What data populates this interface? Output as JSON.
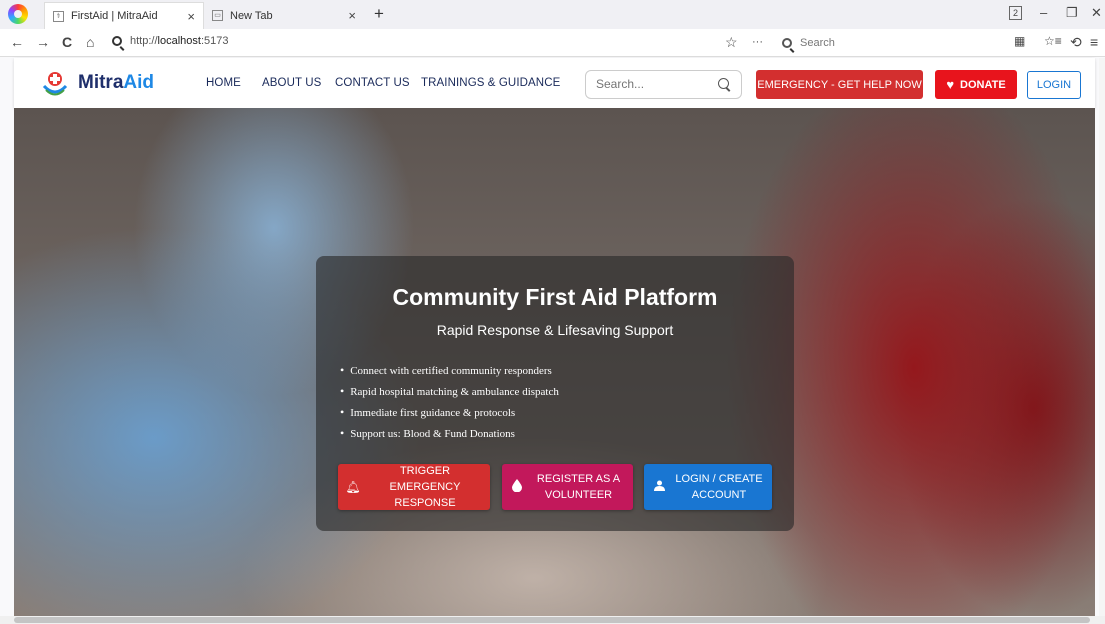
{
  "browser": {
    "tabs": [
      {
        "title": "FirstAid | MitraAid",
        "close": "×"
      },
      {
        "title": "New Tab",
        "close": "×"
      }
    ],
    "new_tab": "+",
    "window_badge": "2",
    "window_controls": {
      "minimize": "–",
      "restore": "❐",
      "close": "✕"
    },
    "nav": {
      "back": "←",
      "forward": "→",
      "reload": "C",
      "home": "⌂"
    },
    "url_prefix": "http://",
    "url_host": "localhost",
    "url_port": ":5173",
    "bookmark_star": "☆",
    "more": "···",
    "search_placeholder": "Search",
    "toolbar_right": [
      "▦",
      "☆≡",
      "⟲",
      "≡"
    ]
  },
  "site": {
    "logo_main": "Mitra",
    "logo_accent": "Aid",
    "nav_links": [
      "HOME",
      "ABOUT US",
      "CONTACT US",
      "TRAININGS & GUIDANCE"
    ],
    "search_placeholder": "Search...",
    "emergency_label": "EMERGENCY - GET HELP NOW",
    "donate_label": "DONATE",
    "login_label": "LOGIN"
  },
  "hero": {
    "title": "Community First Aid Platform",
    "subtitle": "Rapid Response & Lifesaving Support",
    "bullets": [
      "Connect with certified community responders",
      "Rapid hospital matching & ambulance dispatch",
      "Immediate first guidance & protocols",
      "Support us: Blood & Fund Donations"
    ],
    "cta": {
      "trigger_line1": "TRIGGER EMERGENCY",
      "trigger_line2": "RESPONSE",
      "volunteer_line1": "REGISTER AS A",
      "volunteer_line2": "VOLUNTEER",
      "login_line1": "LOGIN / CREATE",
      "login_line2": "ACCOUNT"
    }
  },
  "colors": {
    "emergency": "#d32f2f",
    "donate": "#e8141c",
    "volunteer": "#c2185b",
    "primary": "#1976d2",
    "brand_dark": "#1f2f6b"
  }
}
